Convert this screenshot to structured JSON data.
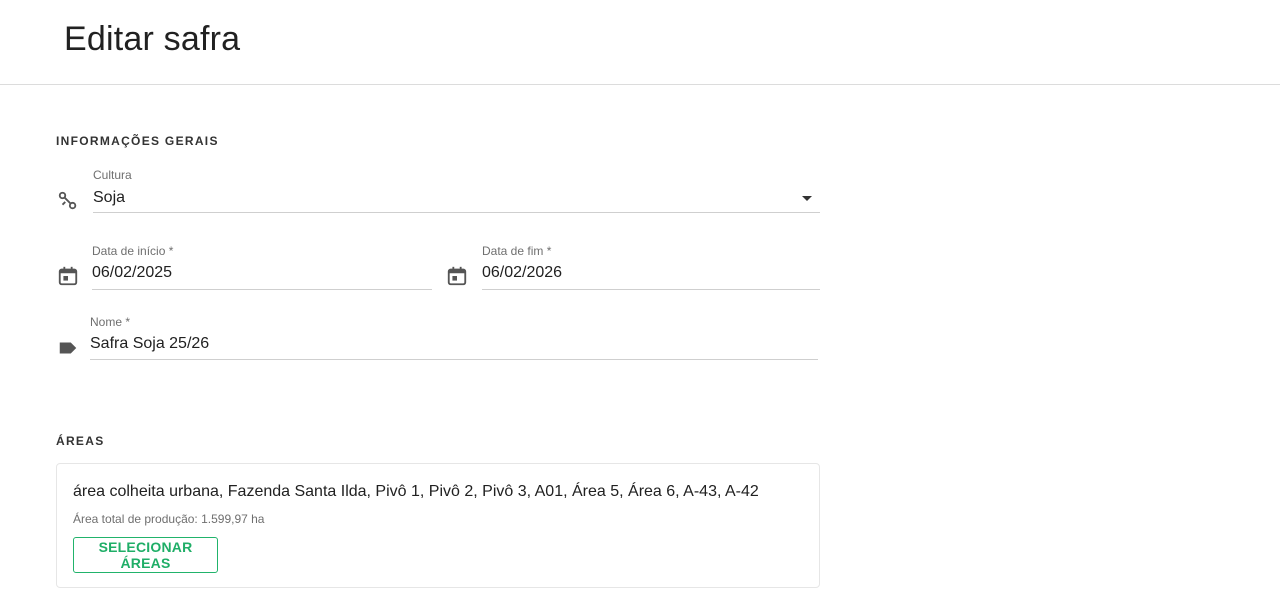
{
  "header": {
    "title": "Editar safra"
  },
  "sections": {
    "general_title": "INFORMAÇÕES GERAIS",
    "areas_title": "ÁREAS"
  },
  "form": {
    "culture": {
      "label": "Cultura",
      "value": "Soja",
      "icon": "plant-icon"
    },
    "start_date": {
      "label": "Data de início *",
      "value": "06/02/2025",
      "icon": "calendar-icon"
    },
    "end_date": {
      "label": "Data de fim *",
      "value": "06/02/2026",
      "icon": "calendar-icon"
    },
    "name": {
      "label": "Nome *",
      "value": "Safra Soja 25/26",
      "icon": "label-tag-icon"
    }
  },
  "areas": {
    "list": "área colheita urbana, Fazenda Santa Ilda, Pivô 1, Pivô 2, Pivô 3, A01, Área 5, Área 6, A-43, A-42",
    "total": "Área total de produção: 1.599,97 ha",
    "select_button": "SELECIONAR ÁREAS"
  },
  "colors": {
    "accent": "#1fae67",
    "text": "#212121",
    "muted": "#6f6f6f",
    "divider": "#dcdcdc"
  }
}
